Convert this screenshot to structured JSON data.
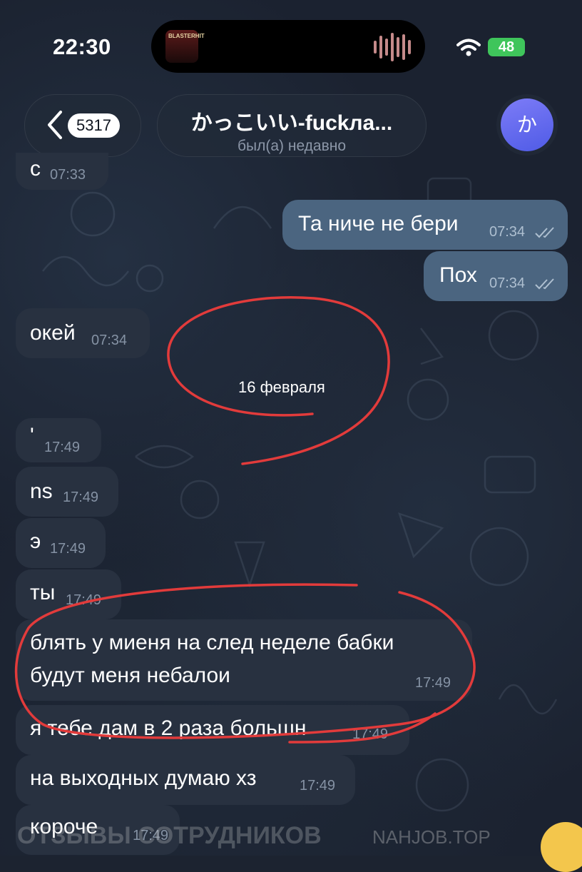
{
  "status_bar": {
    "time": "22:30",
    "battery": "48"
  },
  "island": {
    "art_text": "BLASTERHIT"
  },
  "header": {
    "back_badge": "5317",
    "title": "かっこいい-fuckлa...",
    "subtitle": "был(а) недавно",
    "avatar_letter": "か"
  },
  "messages": [
    {
      "text": "с",
      "time": "07:33",
      "dir": "in"
    },
    {
      "text": "Та ниче не бери",
      "time": "07:34",
      "dir": "out"
    },
    {
      "text": "Пох",
      "time": "07:34",
      "dir": "out"
    },
    {
      "text": "окей",
      "time": "07:34",
      "dir": "in"
    },
    {
      "text": "'",
      "time": "17:49",
      "dir": "in"
    },
    {
      "text": "ns",
      "time": "17:49",
      "dir": "in"
    },
    {
      "text": "э",
      "time": "17:49",
      "dir": "in"
    },
    {
      "text": "ты",
      "time": "17:49",
      "dir": "in"
    },
    {
      "text": "блять у миеня на след неделе бабки",
      "text2": "будут меня небалои",
      "time": "17:49",
      "dir": "in"
    },
    {
      "text": "я тебе дам в 2 раза большн",
      "time": "17:49",
      "dir": "in"
    },
    {
      "text": "на выходных думаю хз",
      "time": "17:49",
      "dir": "in"
    },
    {
      "text": "короче",
      "time": "17:49",
      "dir": "in"
    }
  ],
  "date_separator": "16 февраля",
  "watermark": {
    "left": "ОТЗЫВЫ СОТРУДНИКОВ",
    "right": "NAHJOB.TOP"
  }
}
